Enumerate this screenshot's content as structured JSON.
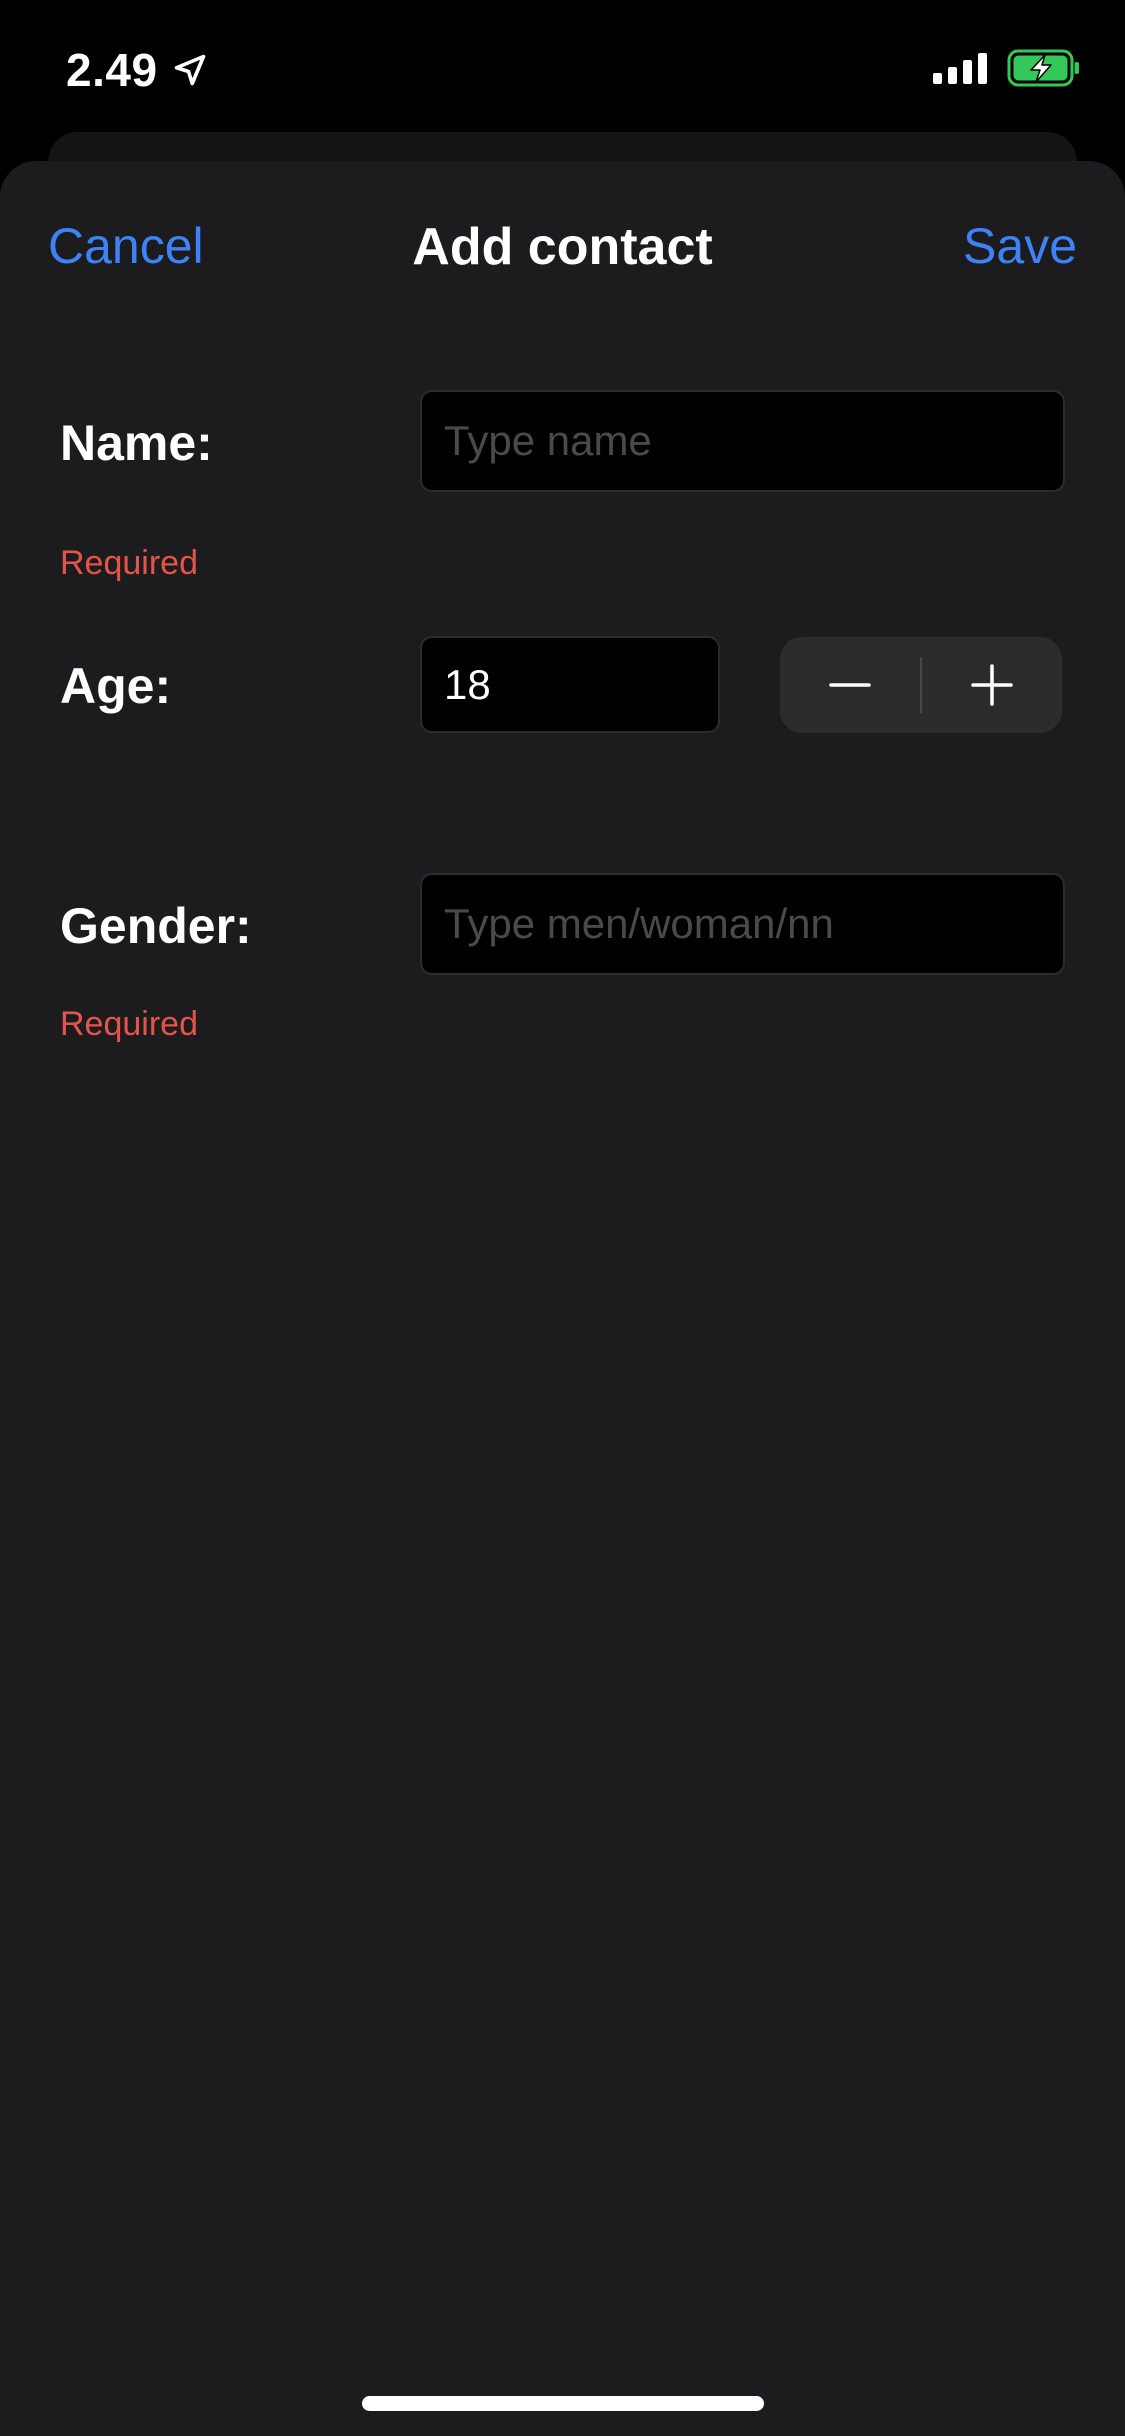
{
  "status_bar": {
    "time": "2.49",
    "location_icon": "location-arrow-icon",
    "signal_icon": "cellular-signal-icon",
    "battery_icon": "battery-charging-icon",
    "battery_color": "#34c759"
  },
  "nav": {
    "cancel_label": "Cancel",
    "title": "Add contact",
    "save_label": "Save",
    "accent_color": "#3d82f6"
  },
  "form": {
    "name": {
      "label": "Name:",
      "value": "",
      "placeholder": "Type name",
      "error": "Required"
    },
    "age": {
      "label": "Age:",
      "value": "18",
      "decrement_icon": "minus-icon",
      "increment_icon": "plus-icon"
    },
    "gender": {
      "label": "Gender:",
      "value": "",
      "placeholder": "Type men/woman/nn",
      "error": "Required"
    },
    "error_color": "#e5544a"
  }
}
